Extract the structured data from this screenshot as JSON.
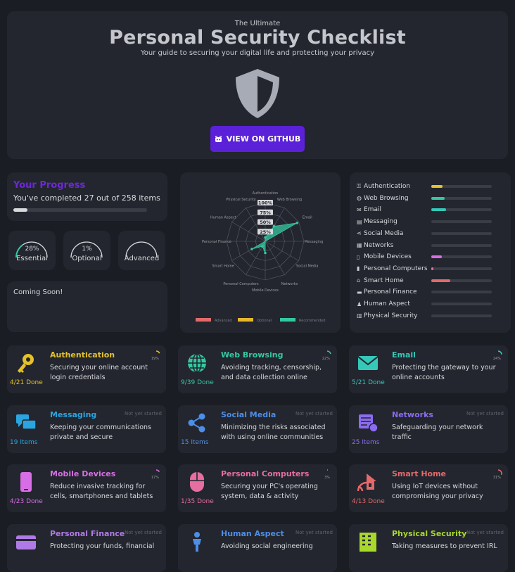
{
  "hero": {
    "pre": "The Ultimate",
    "title": "Personal Security Checklist",
    "subtitle": "Your guide to securing your digital life and protecting your privacy",
    "button_label": "VIEW ON GITHUB"
  },
  "progress": {
    "title": "Your Progress",
    "text": "You've completed 27 out of 258 items",
    "percent": 10.5
  },
  "gauges": [
    {
      "pct": "28%",
      "label": "Essential",
      "value": 28,
      "color": "#35c8a0"
    },
    {
      "pct": "1%",
      "label": "Optional",
      "value": 1,
      "color": "#e5b830"
    },
    {
      "pct": "",
      "label": "Advanced",
      "value": 0,
      "color": "#e36a6a"
    }
  ],
  "coming_soon": "Coming Soon!",
  "radar": {
    "labels": [
      "Authentication",
      "Web Browsing",
      "Email",
      "Messaging",
      "Social Media",
      "Networks",
      "Mobile Devices",
      "Personal Computers",
      "Smart Home",
      "Personal Finance",
      "Human Aspect",
      "Physical Security"
    ],
    "ticks": [
      "100%",
      "75%",
      "50%",
      "25%"
    ],
    "recommended": [
      0.1,
      0.45,
      0.95,
      0.0,
      0.0,
      0.0,
      0.3,
      0.15,
      0.4,
      0.0,
      0.0,
      0.0
    ],
    "legend": [
      "Advanced",
      "Optional",
      "Recommended"
    ],
    "legend_colors": [
      "#e36a6a",
      "#e5b830",
      "#35c8a0"
    ]
  },
  "categories": [
    {
      "icon": "key-icon",
      "glyph": "⚿",
      "name": "Authentication",
      "pct": 19,
      "color": "#e5c22a"
    },
    {
      "icon": "globe-icon",
      "glyph": "◍",
      "name": "Web Browsing",
      "pct": 22,
      "color": "#35c8a0"
    },
    {
      "icon": "mail-icon",
      "glyph": "✉",
      "name": "Email",
      "pct": 24,
      "color": "#35c8b9"
    },
    {
      "icon": "chat-icon",
      "glyph": "▤",
      "name": "Messaging",
      "pct": 0,
      "color": "#2aa5e0"
    },
    {
      "icon": "share-icon",
      "glyph": "⋖",
      "name": "Social Media",
      "pct": 0,
      "color": "#4d8ee6"
    },
    {
      "icon": "network-icon",
      "glyph": "▦",
      "name": "Networks",
      "pct": 0,
      "color": "#8b6cf0"
    },
    {
      "icon": "phone-icon",
      "glyph": "▯",
      "name": "Mobile Devices",
      "pct": 17,
      "color": "#d86ee6"
    },
    {
      "icon": "mouse-icon",
      "glyph": "▮",
      "name": "Personal Computers",
      "pct": 3,
      "color": "#e66ea0"
    },
    {
      "icon": "home-icon",
      "glyph": "⌂",
      "name": "Smart Home",
      "pct": 31,
      "color": "#e36a6a"
    },
    {
      "icon": "card-icon",
      "glyph": "▬",
      "name": "Personal Finance",
      "pct": 0,
      "color": "#b07ae6"
    },
    {
      "icon": "person-icon",
      "glyph": "♟",
      "name": "Human Aspect",
      "pct": 0,
      "color": "#4d8ee6"
    },
    {
      "icon": "building-icon",
      "glyph": "▥",
      "name": "Physical Security",
      "pct": 0,
      "color": "#a8d82a"
    }
  ],
  "cards": [
    {
      "title": "Authentication",
      "desc": "Securing your online account login credentials",
      "done": "4/21 Done",
      "pct": "19%",
      "pctv": 19,
      "color": "#e5c22a",
      "icon": "key-icon"
    },
    {
      "title": "Web Browsing",
      "desc": "Avoiding tracking, censorship, and data collection online",
      "done": "9/39 Done",
      "pct": "22%",
      "pctv": 22,
      "color": "#35c8a0",
      "icon": "globe-icon"
    },
    {
      "title": "Email",
      "desc": "Protecting the gateway to your online accounts",
      "done": "5/21 Done",
      "pct": "24%",
      "pctv": 24,
      "color": "#35c8b9",
      "icon": "mail-icon"
    },
    {
      "title": "Messaging",
      "desc": "Keeping your communications private and secure",
      "done": "19 Items",
      "status": "Not yet started",
      "color": "#2aa5e0",
      "icon": "chat-icon"
    },
    {
      "title": "Social Media",
      "desc": "Minimizing the risks associated with using online communities",
      "done": "15 Items",
      "status": "Not yet started",
      "color": "#4d8ee6",
      "icon": "share-icon"
    },
    {
      "title": "Networks",
      "desc": "Safeguarding your network traffic",
      "done": "25 Items",
      "status": "Not yet started",
      "color": "#8b6cf0",
      "icon": "network-icon"
    },
    {
      "title": "Mobile Devices",
      "desc": "Reduce invasive tracking for cells, smartphones and tablets",
      "done": "4/23 Done",
      "pct": "17%",
      "pctv": 17,
      "color": "#d86ee6",
      "icon": "phone-icon"
    },
    {
      "title": "Personal Computers",
      "desc": "Securing your PC's operating system, data & activity",
      "done": "1/35 Done",
      "pct": "3%",
      "pctv": 3,
      "color": "#e66ea0",
      "icon": "mouse-icon"
    },
    {
      "title": "Smart Home",
      "desc": "Using IoT devices without compromising your privacy",
      "done": "4/13 Done",
      "pct": "31%",
      "pctv": 31,
      "color": "#e36a6a",
      "icon": "home-icon"
    },
    {
      "title": "Personal Finance",
      "desc": "Protecting your funds, financial",
      "done": "",
      "status": "Not yet started",
      "color": "#b07ae6",
      "icon": "card-icon"
    },
    {
      "title": "Human Aspect",
      "desc": "Avoiding social engineering",
      "done": "",
      "status": "Not yet started",
      "color": "#4d8ee6",
      "icon": "person-icon"
    },
    {
      "title": "Physical Security",
      "desc": "Taking measures to prevent IRL",
      "done": "",
      "status": "Not yet started",
      "color": "#a8d82a",
      "icon": "building-icon"
    }
  ]
}
